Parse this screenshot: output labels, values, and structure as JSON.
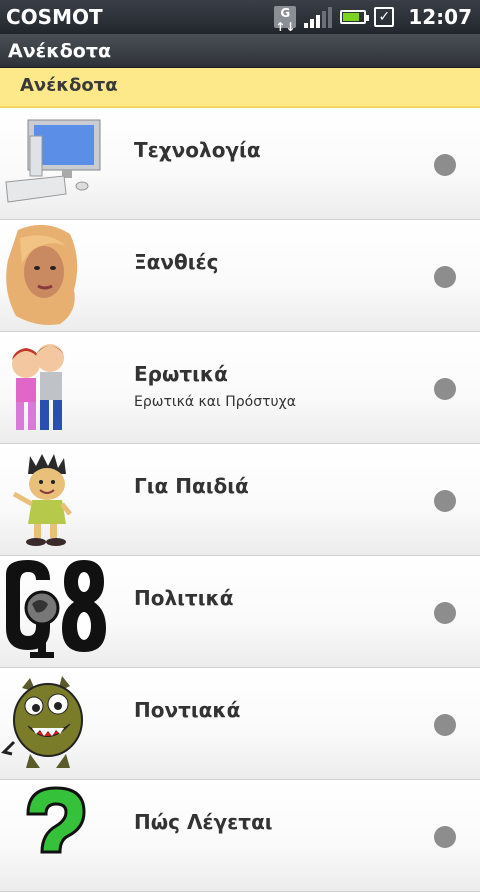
{
  "status_bar": {
    "carrier": "COSMOT",
    "time": "12:07",
    "g_icon_label": "G",
    "icons": [
      "g-icon",
      "signal-icon",
      "battery-icon",
      "checkbox-icon"
    ]
  },
  "title_bar": {
    "title": "Ανέκδοτα"
  },
  "header": {
    "label": "Ανέκδοτα"
  },
  "categories": [
    {
      "title": "Τεχνολογία",
      "subtitle": "",
      "icon": "computer-icon"
    },
    {
      "title": "Ξανθιές",
      "subtitle": "",
      "icon": "blonde-woman-icon"
    },
    {
      "title": "Ερωτικά",
      "subtitle": "Ερωτικά και Πρόστυχα",
      "icon": "couple-icon"
    },
    {
      "title": "Για Παιδιά",
      "subtitle": "",
      "icon": "child-icon"
    },
    {
      "title": "Πολιτικά",
      "subtitle": "",
      "icon": "g8-icon"
    },
    {
      "title": "Ποντιακά",
      "subtitle": "",
      "icon": "monster-icon"
    },
    {
      "title": "Πώς Λέγεται",
      "subtitle": "",
      "icon": "question-mark-icon"
    }
  ],
  "colors": {
    "header_bg": "#fde98a",
    "status_bar_bg": "#22262c",
    "dot": "#8d8d8d"
  }
}
